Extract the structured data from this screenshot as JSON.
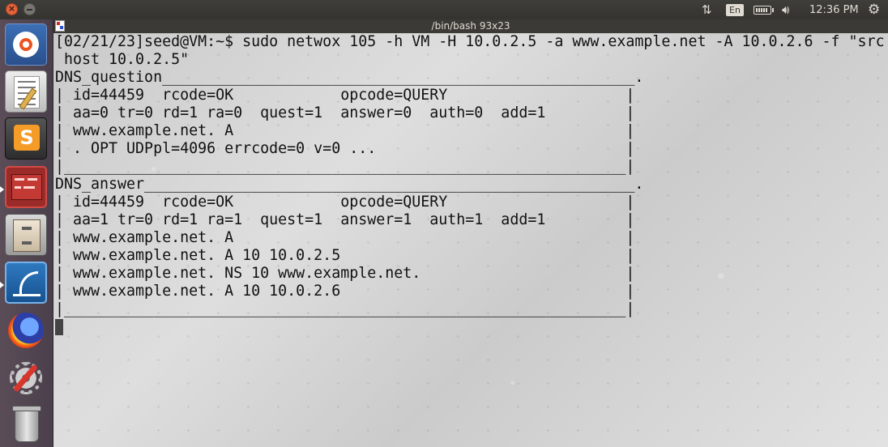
{
  "top_panel": {
    "language": "En",
    "clock": "12:36 PM"
  },
  "icons": {
    "close": "close-icon",
    "minimize": "minimize-icon",
    "sort": "sort-arrows-icon",
    "battery": "battery-icon",
    "volume": "volume-icon",
    "settings": "gear-icon"
  },
  "launcher": {
    "items": [
      "ubuntu-dash",
      "text-editor",
      "sublime-text",
      "terminal",
      "files",
      "wireshark",
      "firefox",
      "system-settings",
      "trash"
    ]
  },
  "terminal": {
    "title": "/bin/bash 93x23",
    "lines": [
      "[02/21/23]seed@VM:~$ sudo netwox 105 -h VM -H 10.0.2.5 -a www.example.net -A 10.0.2.6 -f \"src",
      " host 10.0.2.5\"",
      "DNS_question_____________________________________________________.",
      "| id=44459  rcode=OK            opcode=QUERY                    |",
      "| aa=0 tr=0 rd=1 ra=0  quest=1  answer=0  auth=0  add=1         |",
      "| www.example.net. A                                            |",
      "| . OPT UDPpl=4096 errcode=0 v=0 ...                            |",
      "|_______________________________________________________________|",
      "DNS_answer_______________________________________________________.",
      "| id=44459  rcode=OK            opcode=QUERY                    |",
      "| aa=1 tr=0 rd=1 ra=1  quest=1  answer=1  auth=1  add=1         |",
      "| www.example.net. A                                            |",
      "| www.example.net. A 10 10.0.2.5                                |",
      "| www.example.net. NS 10 www.example.net.                       |",
      "| www.example.net. A 10 10.0.2.6                                |",
      "|_______________________________________________________________|"
    ]
  }
}
